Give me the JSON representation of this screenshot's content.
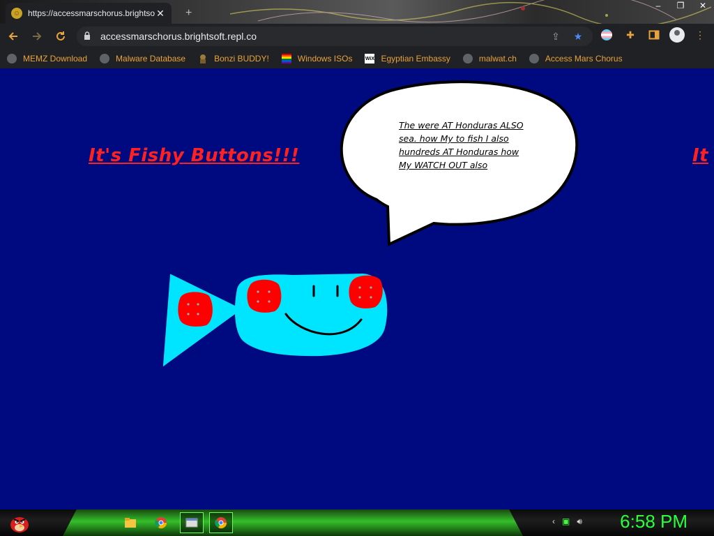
{
  "browser": {
    "tab": {
      "title": "https://accessmarschorus.brightsoft.repl.co",
      "close": "✕"
    },
    "window_controls": [
      "–",
      "❐",
      "✕"
    ],
    "url": "accessmarschorus.brightsoft.repl.co",
    "bookmarks": [
      {
        "label": "MEMZ Download",
        "icon": "globe-icon"
      },
      {
        "label": "Malware Database",
        "icon": "globe-icon"
      },
      {
        "label": "Bonzi BUDDY!",
        "icon": "bonzi-icon"
      },
      {
        "label": "Windows ISOs",
        "icon": "rainbow-flag-icon"
      },
      {
        "label": "Egyptian Embassy",
        "icon": "wix-icon"
      },
      {
        "label": "malwat.ch",
        "icon": "globe-icon"
      },
      {
        "label": "Access Mars Chorus",
        "icon": "globe-icon"
      }
    ]
  },
  "page": {
    "heading": "It's Fishy Buttons!!!",
    "heading_clipped": "It",
    "speech_bubble_text": "The were AT Honduras ALSO sea. how My to fish I also hundreds AT Honduras how My WATCH OUT also",
    "colors": {
      "background": "#000a80",
      "heading": "#ff2020",
      "fish": "#00e5ff",
      "buttons": "#ff0000"
    }
  },
  "taskbar": {
    "clock": "6:58 PM",
    "apps": [
      "angry-bird-icon",
      "file-explorer-icon",
      "chrome-icon",
      "window-icon",
      "chrome-icon"
    ]
  }
}
